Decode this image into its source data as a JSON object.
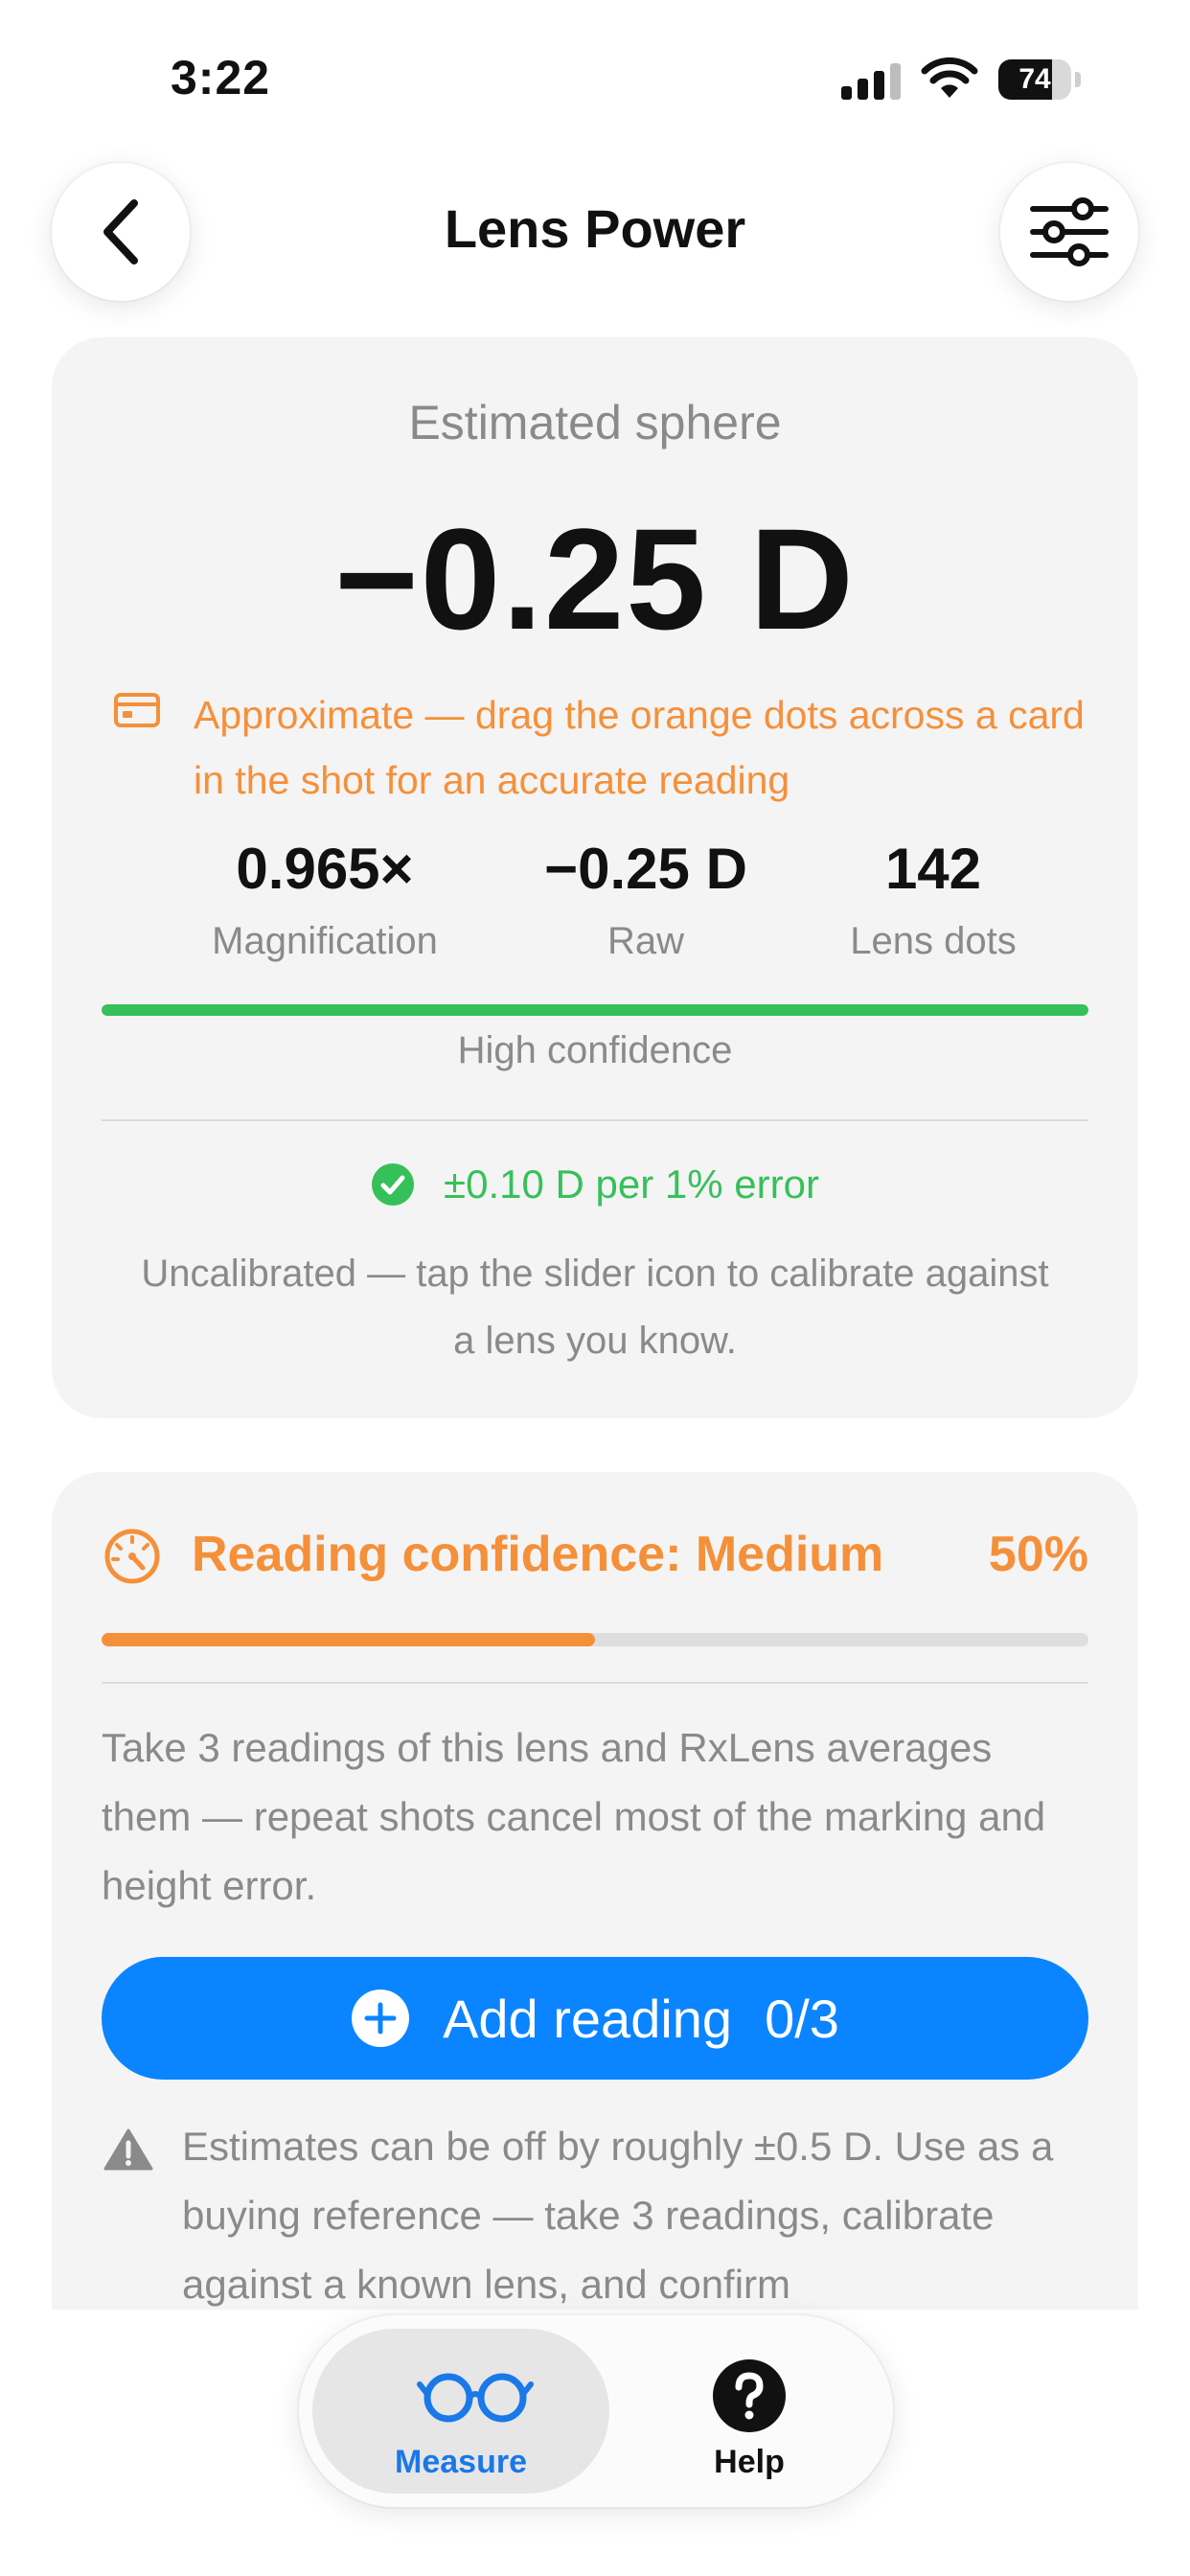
{
  "status": {
    "time": "3:22",
    "battery": "74",
    "battery_level": 0.74
  },
  "header": {
    "title": "Lens Power"
  },
  "estimate": {
    "label": "Estimated sphere",
    "value": "−0.25 D",
    "approx_note": "Approximate — drag the orange dots across a card in the shot for an accurate reading",
    "stats": [
      {
        "value": "0.965×",
        "label": "Magnification"
      },
      {
        "value": "−0.25 D",
        "label": "Raw"
      },
      {
        "value": "142",
        "label": "Lens dots"
      }
    ],
    "confidence_label": "High confidence",
    "confidence_level": 1.0,
    "error_note": "±0.10 D per 1% error",
    "uncalibrated_note": "Uncalibrated — tap the slider icon to calibrate against a lens you know."
  },
  "reading": {
    "title": "Reading confidence: Medium",
    "percent": "50%",
    "progress": 0.5,
    "description": "Take 3 readings of this lens and RxLens averages them — repeat shots cancel most of the marking and height error.",
    "add_button_label": "Add reading",
    "add_button_count": "0/3",
    "warning": "Estimates can be off by roughly ±0.5 D. Use as a buying reference — take 3 readings, calibrate against a known lens, and confirm"
  },
  "tabs": [
    {
      "label": "Measure",
      "icon": "glasses-icon",
      "active": true
    },
    {
      "label": "Help",
      "icon": "help-icon",
      "active": false
    }
  ],
  "colors": {
    "orange": "#f5903a",
    "green": "#36c05a",
    "blue": "#0a84ff",
    "active_tab": "#1a78e8"
  }
}
